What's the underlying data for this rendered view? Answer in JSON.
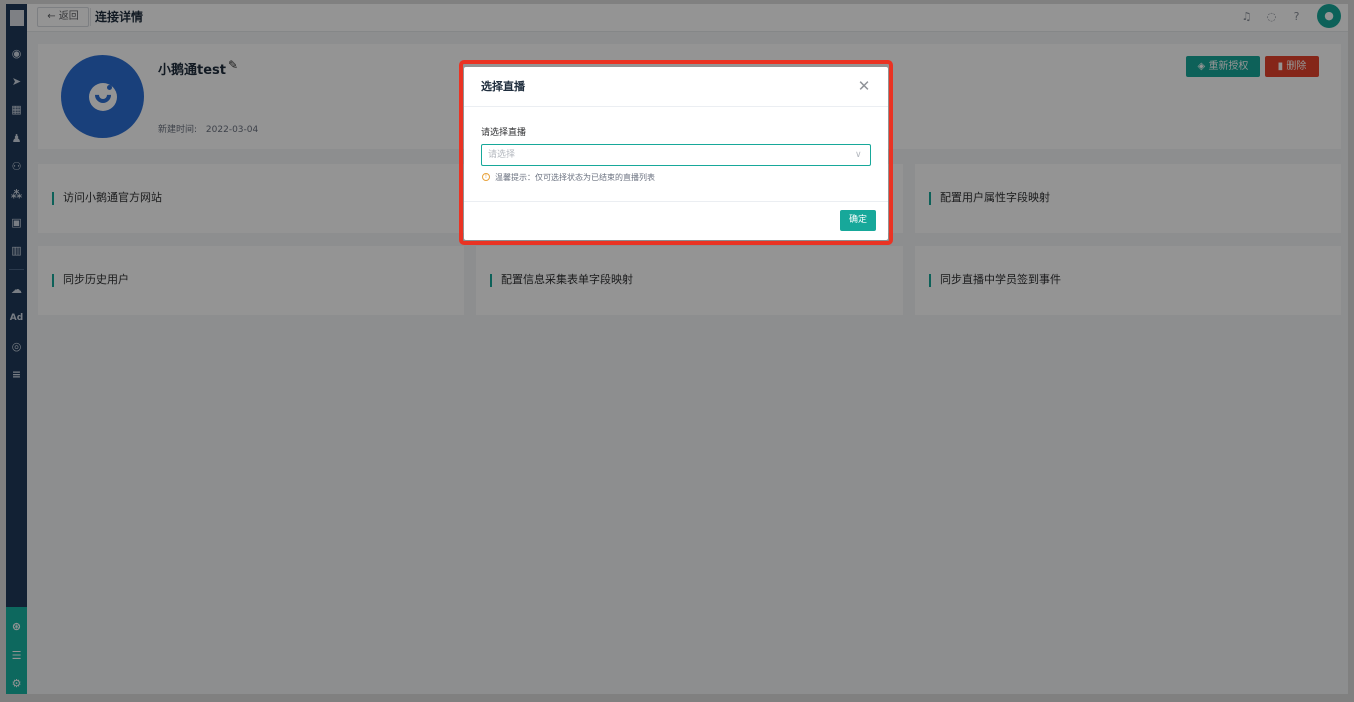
{
  "header": {
    "back_label": "← 返回",
    "title": "连接详情"
  },
  "profile": {
    "name": "小鹅通test",
    "created_label": "新建时间:",
    "created_date": "2022-03-04",
    "reauth_label": "重新授权",
    "delete_label": "删除"
  },
  "cards": [
    {
      "label": "访问小鹅通官方网站"
    },
    {
      "label": "配置用户属性字段映射"
    },
    {
      "label": "同步历史用户"
    },
    {
      "label": "配置信息采集表单字段映射"
    },
    {
      "label": "同步直播中学员签到事件"
    }
  ],
  "modal": {
    "title": "选择直播",
    "field_label": "请选择直播",
    "select_placeholder": "请选择",
    "hint": "温馨提示：仅可选择状态为已结束的直播列表",
    "confirm_label": "确定"
  },
  "sidebar": {
    "ad_label": "Ad"
  },
  "colors": {
    "accent": "#17a89a",
    "danger": "#e5432b",
    "sidebar_bg": "#1f3a5a",
    "highlight": "#ea3323"
  }
}
